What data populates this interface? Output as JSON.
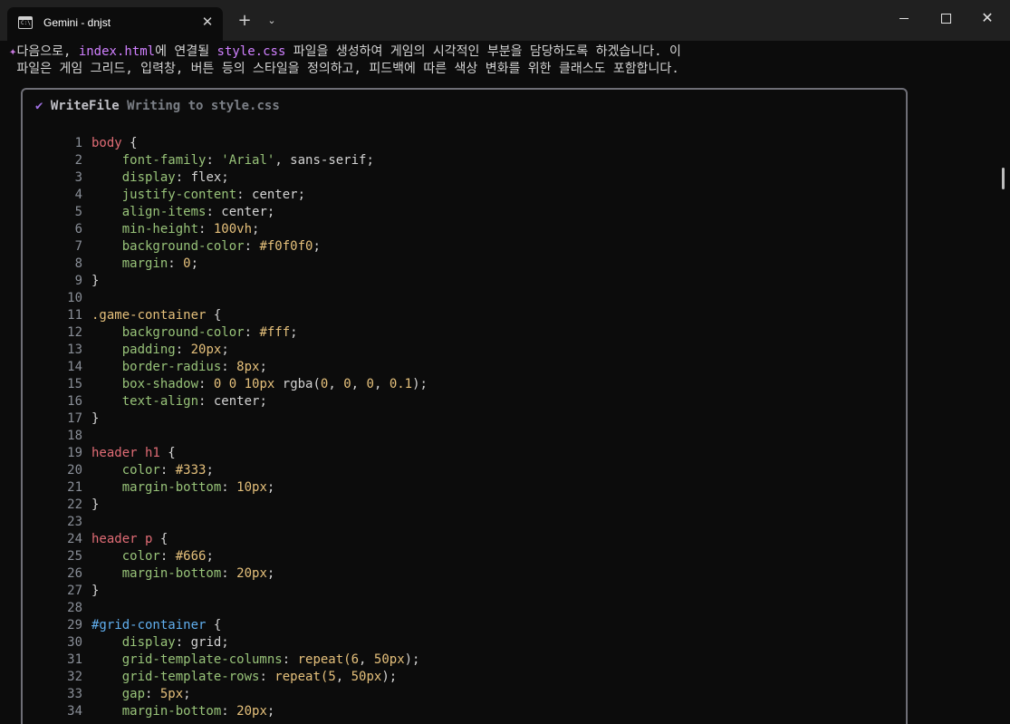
{
  "window": {
    "tab_title": "Gemini - dnjst",
    "tab_icon": "terminal-icon",
    "tab_icon_glyph": "C:\\",
    "close_tab_glyph": "✕",
    "new_tab_glyph": "+",
    "tab_menu_glyph": "⌄",
    "close_glyph": "✕"
  },
  "message": {
    "icon": "sparkle-icon",
    "glyph": "✦",
    "line1_segments": [
      {
        "text": "다음으로, ",
        "style": "plain"
      },
      {
        "text": "index.html",
        "style": "hl"
      },
      {
        "text": "에 연결될 ",
        "style": "plain"
      },
      {
        "text": "style.css",
        "style": "hl"
      },
      {
        "text": " 파일을 생성하여 게임의 시각적인 부분을 담당하도록 하겠습니다. 이",
        "style": "plain"
      }
    ],
    "line2": " 파일은 게임 그리드, 입력창, 버튼 등의 스타일을 정의하고, 피드백에 따른 색상 변화를 위한 클래스도 포함합니다."
  },
  "tool": {
    "check_glyph": "✔",
    "name": "WriteFile",
    "description": "Writing to style.css"
  },
  "code_lines": [
    {
      "n": "1",
      "tokens": [
        [
          "body",
          "sel"
        ],
        [
          " {",
          "punc"
        ]
      ]
    },
    {
      "n": "2",
      "tokens": [
        [
          "    ",
          "val"
        ],
        [
          "font-family",
          "prop"
        ],
        [
          ": ",
          "punc"
        ],
        [
          "'Arial'",
          "str"
        ],
        [
          ", sans-serif;",
          "val"
        ]
      ]
    },
    {
      "n": "3",
      "tokens": [
        [
          "    ",
          "val"
        ],
        [
          "display",
          "prop"
        ],
        [
          ": flex;",
          "val"
        ]
      ]
    },
    {
      "n": "4",
      "tokens": [
        [
          "    ",
          "val"
        ],
        [
          "justify-content",
          "prop"
        ],
        [
          ": center;",
          "val"
        ]
      ]
    },
    {
      "n": "5",
      "tokens": [
        [
          "    ",
          "val"
        ],
        [
          "align-items",
          "prop"
        ],
        [
          ": center;",
          "val"
        ]
      ]
    },
    {
      "n": "6",
      "tokens": [
        [
          "    ",
          "val"
        ],
        [
          "min-height",
          "prop"
        ],
        [
          ": ",
          "punc"
        ],
        [
          "100vh",
          "num"
        ],
        [
          ";",
          "punc"
        ]
      ]
    },
    {
      "n": "7",
      "tokens": [
        [
          "    ",
          "val"
        ],
        [
          "background-color",
          "prop"
        ],
        [
          ": ",
          "punc"
        ],
        [
          "#f0f0f0",
          "hex"
        ],
        [
          ";",
          "punc"
        ]
      ]
    },
    {
      "n": "8",
      "tokens": [
        [
          "    ",
          "val"
        ],
        [
          "margin",
          "prop"
        ],
        [
          ": ",
          "punc"
        ],
        [
          "0",
          "num"
        ],
        [
          ";",
          "punc"
        ]
      ]
    },
    {
      "n": "9",
      "tokens": [
        [
          "}",
          "punc"
        ]
      ]
    },
    {
      "n": "10",
      "tokens": []
    },
    {
      "n": "11",
      "tokens": [
        [
          ".game-container",
          "cls"
        ],
        [
          " {",
          "punc"
        ]
      ]
    },
    {
      "n": "12",
      "tokens": [
        [
          "    ",
          "val"
        ],
        [
          "background-color",
          "prop"
        ],
        [
          ": ",
          "punc"
        ],
        [
          "#fff",
          "hex"
        ],
        [
          ";",
          "punc"
        ]
      ]
    },
    {
      "n": "13",
      "tokens": [
        [
          "    ",
          "val"
        ],
        [
          "padding",
          "prop"
        ],
        [
          ": ",
          "punc"
        ],
        [
          "20px",
          "num"
        ],
        [
          ";",
          "punc"
        ]
      ]
    },
    {
      "n": "14",
      "tokens": [
        [
          "    ",
          "val"
        ],
        [
          "border-radius",
          "prop"
        ],
        [
          ": ",
          "punc"
        ],
        [
          "8px",
          "num"
        ],
        [
          ";",
          "punc"
        ]
      ]
    },
    {
      "n": "15",
      "tokens": [
        [
          "    ",
          "val"
        ],
        [
          "box-shadow",
          "prop"
        ],
        [
          ": ",
          "punc"
        ],
        [
          "0",
          "num"
        ],
        [
          " ",
          "punc"
        ],
        [
          "0",
          "num"
        ],
        [
          " ",
          "punc"
        ],
        [
          "10px",
          "num"
        ],
        [
          " rgba(",
          "val"
        ],
        [
          "0",
          "num"
        ],
        [
          ", ",
          "punc"
        ],
        [
          "0",
          "num"
        ],
        [
          ", ",
          "punc"
        ],
        [
          "0",
          "num"
        ],
        [
          ", ",
          "punc"
        ],
        [
          "0.1",
          "num"
        ],
        [
          ");",
          "punc"
        ]
      ]
    },
    {
      "n": "16",
      "tokens": [
        [
          "    ",
          "val"
        ],
        [
          "text-align",
          "prop"
        ],
        [
          ": center;",
          "val"
        ]
      ]
    },
    {
      "n": "17",
      "tokens": [
        [
          "}",
          "punc"
        ]
      ]
    },
    {
      "n": "18",
      "tokens": []
    },
    {
      "n": "19",
      "tokens": [
        [
          "header h1",
          "sel"
        ],
        [
          " {",
          "punc"
        ]
      ]
    },
    {
      "n": "20",
      "tokens": [
        [
          "    ",
          "val"
        ],
        [
          "color",
          "prop"
        ],
        [
          ": ",
          "punc"
        ],
        [
          "#333",
          "hex"
        ],
        [
          ";",
          "punc"
        ]
      ]
    },
    {
      "n": "21",
      "tokens": [
        [
          "    ",
          "val"
        ],
        [
          "margin-bottom",
          "prop"
        ],
        [
          ": ",
          "punc"
        ],
        [
          "10px",
          "num"
        ],
        [
          ";",
          "punc"
        ]
      ]
    },
    {
      "n": "22",
      "tokens": [
        [
          "}",
          "punc"
        ]
      ]
    },
    {
      "n": "23",
      "tokens": []
    },
    {
      "n": "24",
      "tokens": [
        [
          "header p",
          "sel"
        ],
        [
          " {",
          "punc"
        ]
      ]
    },
    {
      "n": "25",
      "tokens": [
        [
          "    ",
          "val"
        ],
        [
          "color",
          "prop"
        ],
        [
          ": ",
          "punc"
        ],
        [
          "#666",
          "hex"
        ],
        [
          ";",
          "punc"
        ]
      ]
    },
    {
      "n": "26",
      "tokens": [
        [
          "    ",
          "val"
        ],
        [
          "margin-bottom",
          "prop"
        ],
        [
          ": ",
          "punc"
        ],
        [
          "20px",
          "num"
        ],
        [
          ";",
          "punc"
        ]
      ]
    },
    {
      "n": "27",
      "tokens": [
        [
          "}",
          "punc"
        ]
      ]
    },
    {
      "n": "28",
      "tokens": []
    },
    {
      "n": "29",
      "tokens": [
        [
          "#grid-container",
          "id"
        ],
        [
          " {",
          "punc"
        ]
      ]
    },
    {
      "n": "30",
      "tokens": [
        [
          "    ",
          "val"
        ],
        [
          "display",
          "prop"
        ],
        [
          ": grid;",
          "val"
        ]
      ]
    },
    {
      "n": "31",
      "tokens": [
        [
          "    ",
          "val"
        ],
        [
          "grid-template-columns",
          "prop"
        ],
        [
          ": ",
          "punc"
        ],
        [
          "repeat(",
          "num"
        ],
        [
          "6",
          "num"
        ],
        [
          ", ",
          "punc"
        ],
        [
          "50px",
          "num"
        ],
        [
          ");",
          "punc"
        ]
      ]
    },
    {
      "n": "32",
      "tokens": [
        [
          "    ",
          "val"
        ],
        [
          "grid-template-rows",
          "prop"
        ],
        [
          ": ",
          "punc"
        ],
        [
          "repeat(",
          "num"
        ],
        [
          "5",
          "num"
        ],
        [
          ", ",
          "punc"
        ],
        [
          "50px",
          "num"
        ],
        [
          ");",
          "punc"
        ]
      ]
    },
    {
      "n": "33",
      "tokens": [
        [
          "    ",
          "val"
        ],
        [
          "gap",
          "prop"
        ],
        [
          ": ",
          "punc"
        ],
        [
          "5px",
          "num"
        ],
        [
          ";",
          "punc"
        ]
      ]
    },
    {
      "n": "34",
      "tokens": [
        [
          "    ",
          "val"
        ],
        [
          "margin-bottom",
          "prop"
        ],
        [
          ": ",
          "punc"
        ],
        [
          "20px",
          "num"
        ],
        [
          ";",
          "punc"
        ]
      ]
    }
  ]
}
